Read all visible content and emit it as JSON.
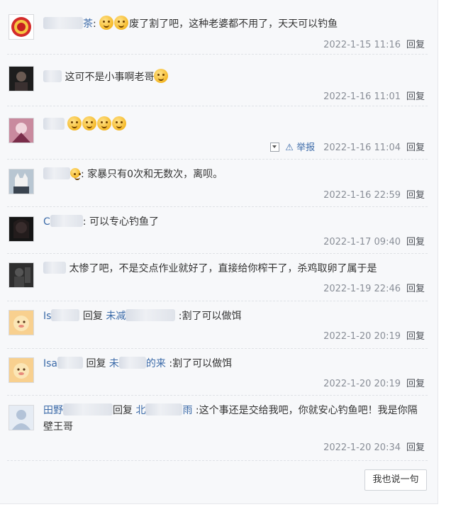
{
  "comments": [
    {
      "user_visible": "",
      "user_suffix": "茶",
      "text": "废了割了吧，这种老婆都不用了，天天可以钓鱼",
      "time": "2022-1-15 11:16",
      "reply": "回复"
    },
    {
      "user_visible": "",
      "text": "这可不是小事啊老哥",
      "time": "2022-1-16 11:01",
      "reply": "回复"
    },
    {
      "user_visible": "",
      "text": "",
      "report": "举报",
      "time": "2022-1-16 11:04",
      "reply": "回复"
    },
    {
      "user_visible": "",
      "text": ": 家暴只有0次和无数次，离呗。",
      "time": "2022-1-16 22:59",
      "reply": "回复"
    },
    {
      "user_visible": "C",
      "text": ": 可以专心钓鱼了",
      "time": "2022-1-17 09:40",
      "reply": "回复"
    },
    {
      "user_visible": "",
      "text": "太惨了吧，不是交点作业就好了，直接给你榨干了，杀鸡取卵了属于是",
      "time": "2022-1-19 22:46",
      "reply": "回复"
    },
    {
      "user_visible": "Is",
      "reply_word": "回复",
      "target": "未减",
      "text": ":割了可以做饵",
      "time": "2022-1-20 20:19",
      "reply": "回复"
    },
    {
      "user_visible": "Isa",
      "reply_word": "回复",
      "target": "未",
      "target_suffix": "的来",
      "text": ":割了可以做饵",
      "time": "2022-1-20 20:19",
      "reply": "回复"
    },
    {
      "user_visible": "田野",
      "reply_word": "回复",
      "target": "北",
      "target_suffix": "雨",
      "text": ":这个事还是交给我吧，你就安心钓鱼吧！我是你隔壁王哥",
      "time": "2022-1-20 20:34",
      "reply": "回复"
    }
  ],
  "footer": {
    "say_button": "我也说一句"
  },
  "colors": {
    "link": "#3b6aa8",
    "panel_bg": "#f7f8fa",
    "meta": "#8a8f98"
  }
}
